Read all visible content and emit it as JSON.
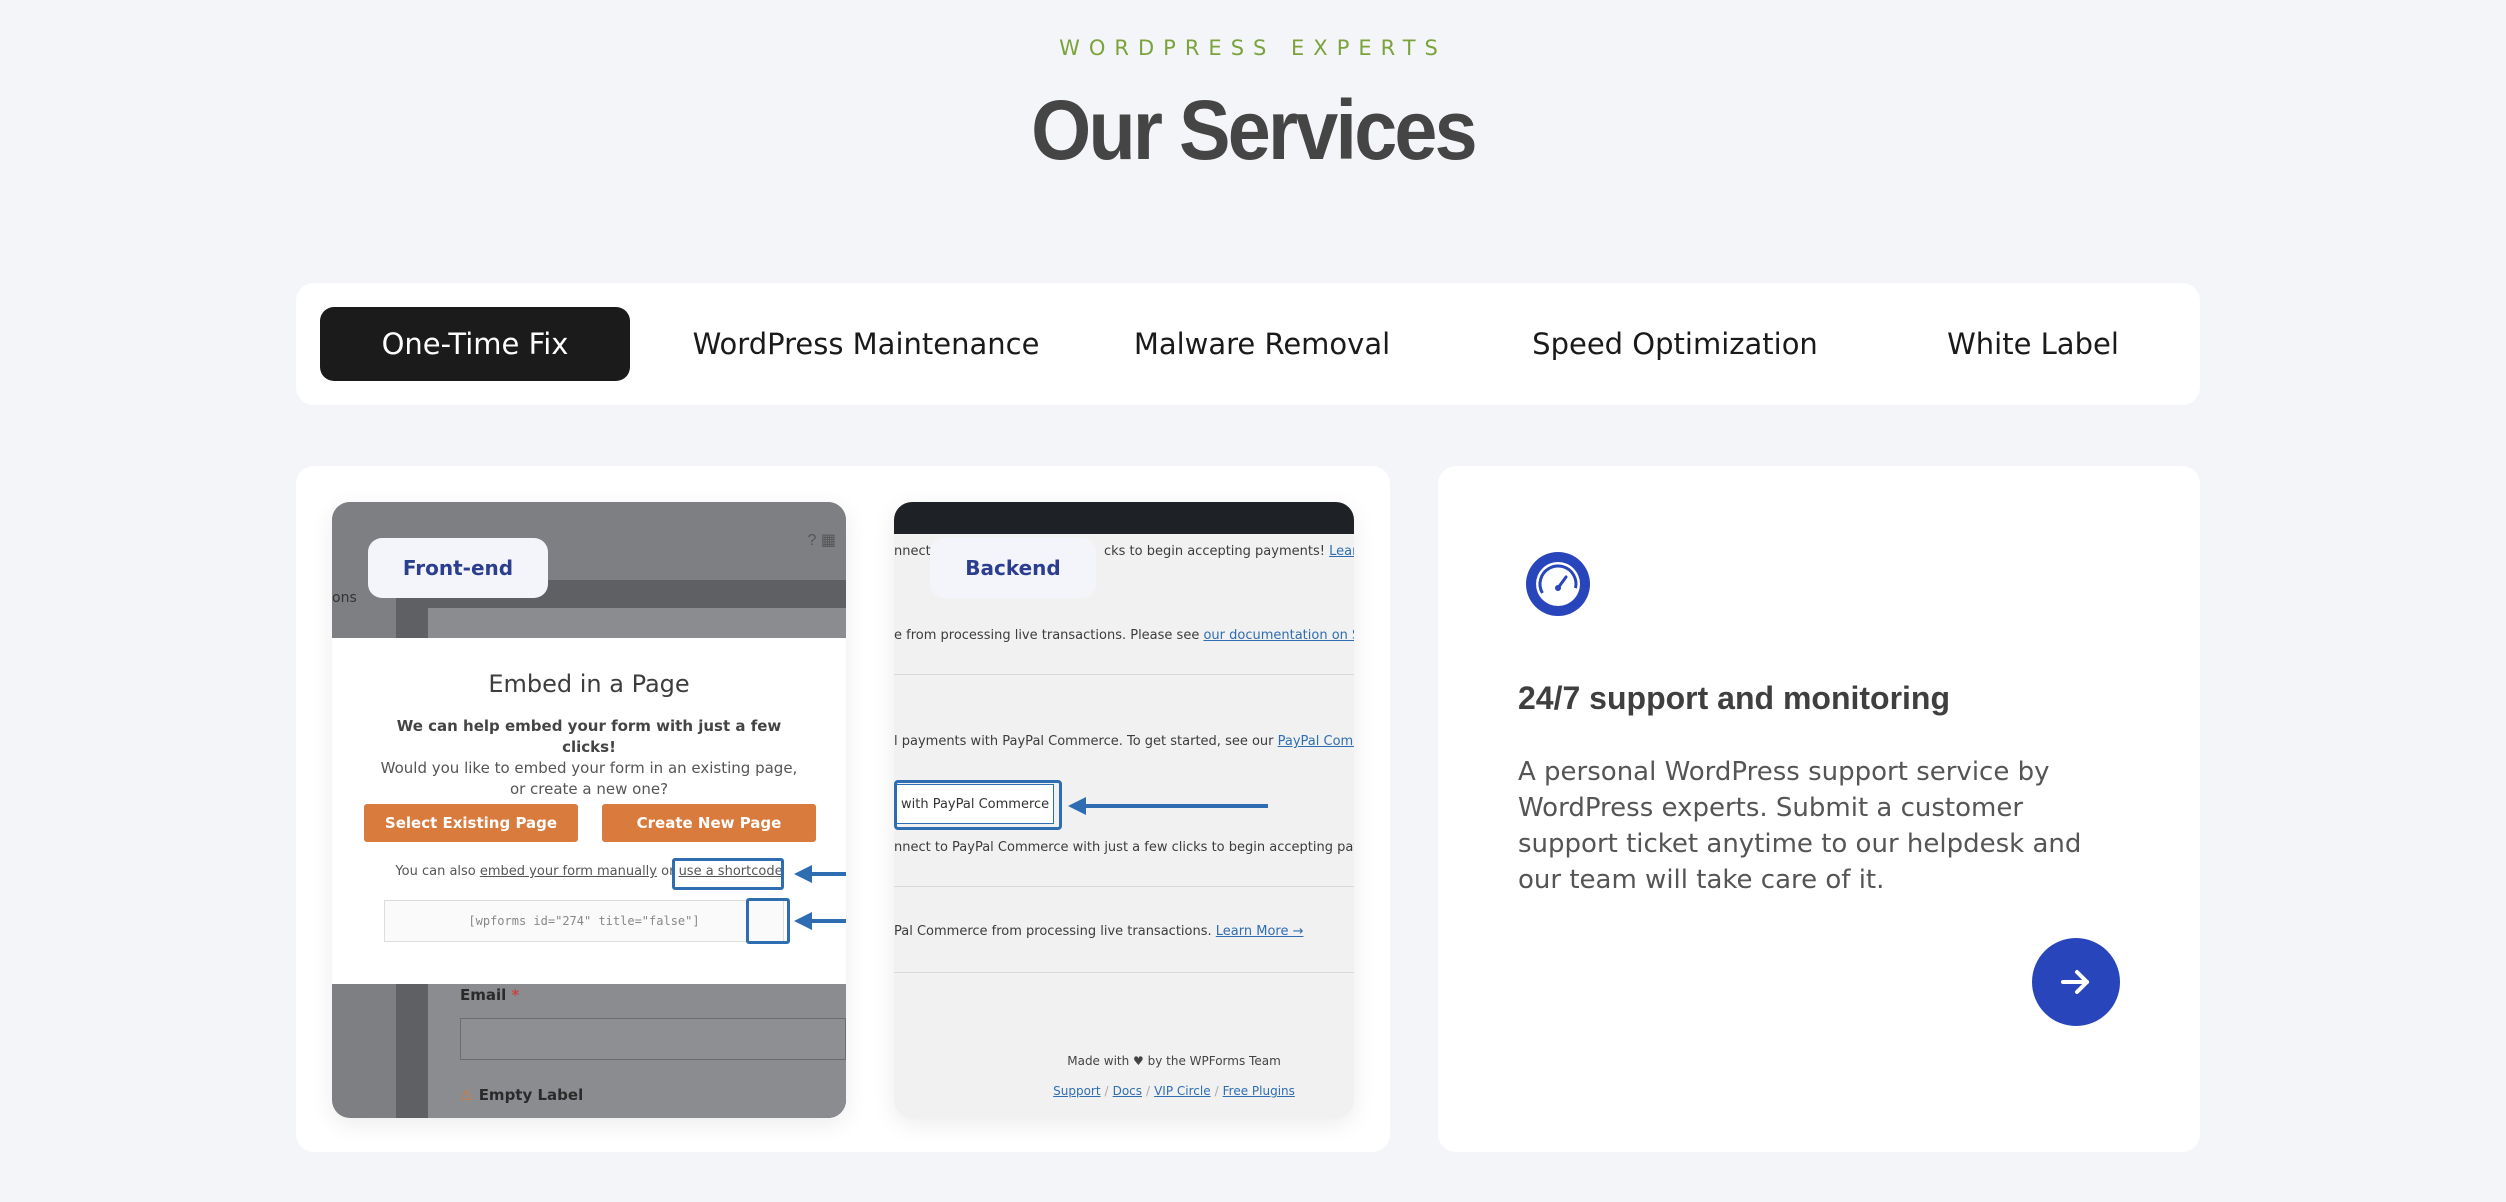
{
  "header": {
    "eyebrow": "WORDPRESS EXPERTS",
    "title": "Our Services"
  },
  "tabs": [
    {
      "label": "One-Time Fix",
      "active": true
    },
    {
      "label": "WordPress Maintenance",
      "active": false
    },
    {
      "label": "Malware Removal",
      "active": false
    },
    {
      "label": "Speed Optimization",
      "active": false
    },
    {
      "label": "White Label",
      "active": false
    }
  ],
  "screens": {
    "frontend": {
      "badge": "Front-end",
      "side_tab": "ons",
      "modal_title": "Embed in a Page",
      "modal_text_bold": "We can help embed your form with just a few clicks!",
      "modal_text": "Would you like to embed your form in an existing page, or create a new one?",
      "btn_existing": "Select Existing Page",
      "btn_new": "Create New Page",
      "also_prefix": "You can also ",
      "also_link1": "embed your form manually",
      "also_mid": " or ",
      "also_link2": "use a shortcode",
      "shortcode": "[wpforms id=\"274\" title=\"false\"]",
      "email_label": "Email",
      "email_required": "*",
      "empty_label": "Empty Label"
    },
    "backend": {
      "badge": "Backend",
      "line1_prefix": "nnect t",
      "line1_suffix": "cks to begin accepting payments!",
      "line1_link": "Learn M",
      "line2": "e from processing live transactions. Please see ",
      "line2_link": "our documentation on Stri",
      "line3": "l payments with PayPal Commerce. To get started, see our ",
      "line3_link": "PayPal Commer",
      "button": "with PayPal Commerce",
      "line4": "nnect to PayPal Commerce with just a few clicks to begin accepting payme",
      "line5": "Pal Commerce from processing live transactions. ",
      "line5_link": "Learn More →",
      "footer_made": "Made with ♥ by the WPForms Team",
      "footer_links": [
        "Support",
        "Docs",
        "VIP Circle",
        "Free Plugins"
      ]
    }
  },
  "feature": {
    "icon": "speedometer-icon",
    "title": "24/7 support and monitoring",
    "description": "A personal WordPress support service by WordPress experts. Submit a customer support ticket anytime to our helpdesk and our team will take care of it.",
    "arrow_icon": "arrow-right-icon"
  },
  "colors": {
    "background": "#f4f5f9",
    "accent_green": "#7aa33b",
    "active_tab": "#1b1b1b",
    "brand_blue": "#2945bb",
    "orange_button": "#d97b3c"
  }
}
